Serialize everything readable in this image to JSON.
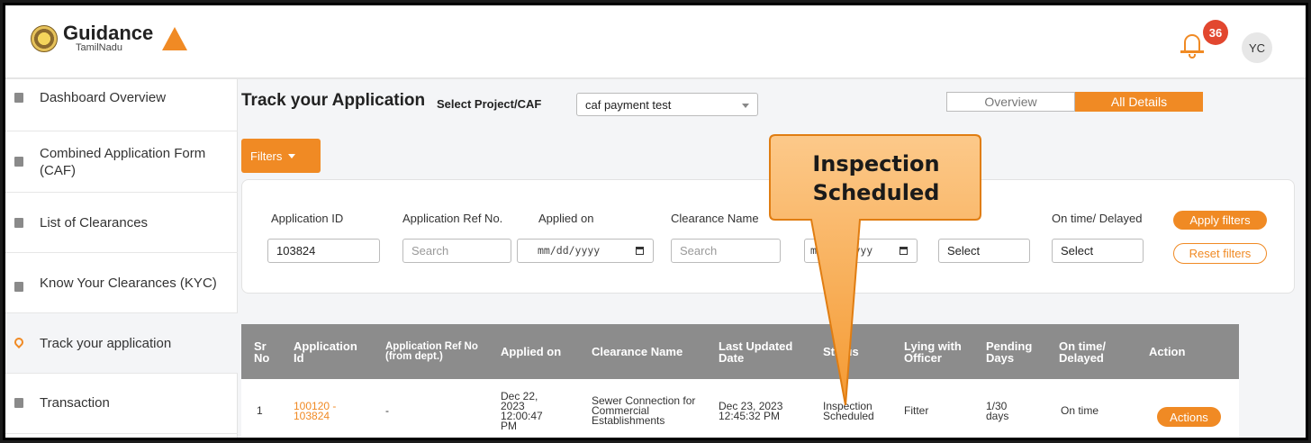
{
  "header": {
    "logo_main": "Guidance",
    "logo_sub": "TamilNadu",
    "notification_count": "36",
    "avatar_initials": "YC"
  },
  "sidebar": {
    "items": [
      {
        "label": "Dashboard Overview",
        "icon": "grid-icon"
      },
      {
        "label": "Combined Application Form (CAF)",
        "icon": "document-icon"
      },
      {
        "label": "List of Clearances",
        "icon": "list-icon"
      },
      {
        "label": "Know Your Clearances (KYC)",
        "icon": "book-icon"
      },
      {
        "label": "Track your application",
        "icon": "location-pin-icon",
        "active": true
      },
      {
        "label": "Transaction",
        "icon": "transaction-icon"
      }
    ]
  },
  "main": {
    "title": "Track your Application",
    "select_label": "Select Project/CAF",
    "project_value": "caf payment test",
    "toggle": {
      "overview": "Overview",
      "all_details": "All Details",
      "active": "all_details"
    }
  },
  "filters": {
    "button_label": "Filters",
    "fields": [
      {
        "label": "Application ID",
        "value": "103824",
        "placeholder": ""
      },
      {
        "label": "Application Ref No.",
        "value": "",
        "placeholder": "Search"
      },
      {
        "label": "Applied on",
        "value": "mm/dd/yyyy",
        "placeholder": ""
      },
      {
        "label": "Clearance Name",
        "value": "",
        "placeholder": "Search"
      },
      {
        "label": "",
        "value": "mm/dd/yyyy",
        "placeholder": ""
      },
      {
        "label": "",
        "value": "Select",
        "placeholder": ""
      },
      {
        "label": "On time/ Delayed",
        "value": "Select",
        "placeholder": ""
      }
    ],
    "apply_label": "Apply filters",
    "reset_label": "Reset filters"
  },
  "table": {
    "headers": [
      "Sr No",
      "Application Id",
      "Application Ref No (from dept.)",
      "Applied on",
      "Clearance Name",
      "Last Updated Date",
      "Status",
      "Lying with Officer",
      "Pending Days",
      "On time/ Delayed",
      "Action"
    ],
    "rows": [
      {
        "sr": "1",
        "app_id": "100120 - 103824",
        "ref_no": "-",
        "applied_on": "Dec 22, 2023 12:00:47 PM",
        "clearance": "Sewer Connection for Commercial Establishments",
        "last_updated": "Dec 23, 2023 12:45:32 PM",
        "status": "Inspection Scheduled",
        "officer": "Fitter",
        "pending": "1/30 days",
        "on_time": "On time",
        "action_label": "Actions"
      }
    ]
  },
  "callout": {
    "text": "Inspection Scheduled",
    "fill_color": "#f7a544",
    "stroke_color": "#e07d12"
  },
  "colors": {
    "accent": "#f08a24",
    "table_header": "#8c8c8c",
    "badge": "#e2472f"
  }
}
